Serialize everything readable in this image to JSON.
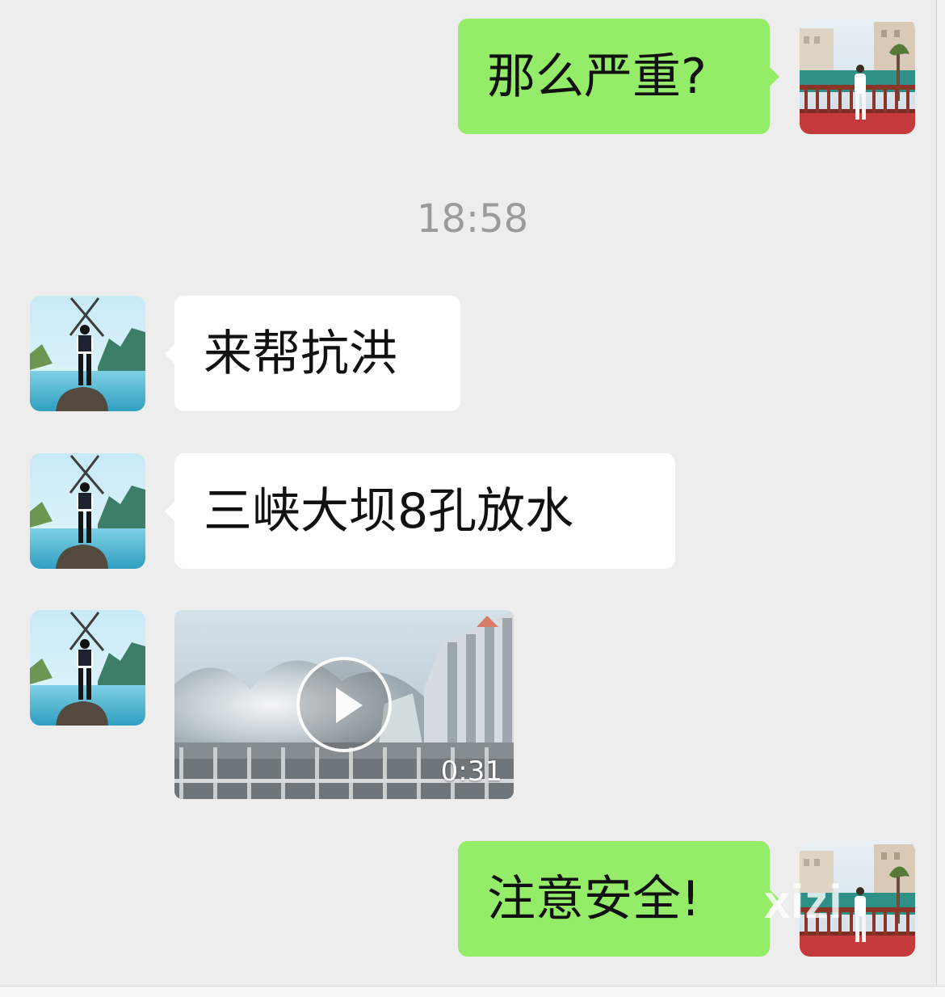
{
  "conversation": {
    "messages": [
      {
        "sender": "self",
        "type": "text",
        "text": "那么严重?"
      },
      {
        "type": "timestamp",
        "text": "18:58"
      },
      {
        "sender": "contact",
        "type": "text",
        "text": "来帮抗洪"
      },
      {
        "sender": "contact",
        "type": "text",
        "text": "三峡大坝8孔放水"
      },
      {
        "sender": "contact",
        "type": "video",
        "duration": "0:31",
        "icon": "play-icon"
      },
      {
        "sender": "self",
        "type": "text",
        "text": "注意安全!"
      }
    ]
  },
  "watermark": {
    "text": "xizi"
  },
  "colors": {
    "background": "#ededed",
    "self_bubble": "#95ec69",
    "contact_bubble": "#ffffff",
    "timestamp": "#9b9b9b"
  }
}
